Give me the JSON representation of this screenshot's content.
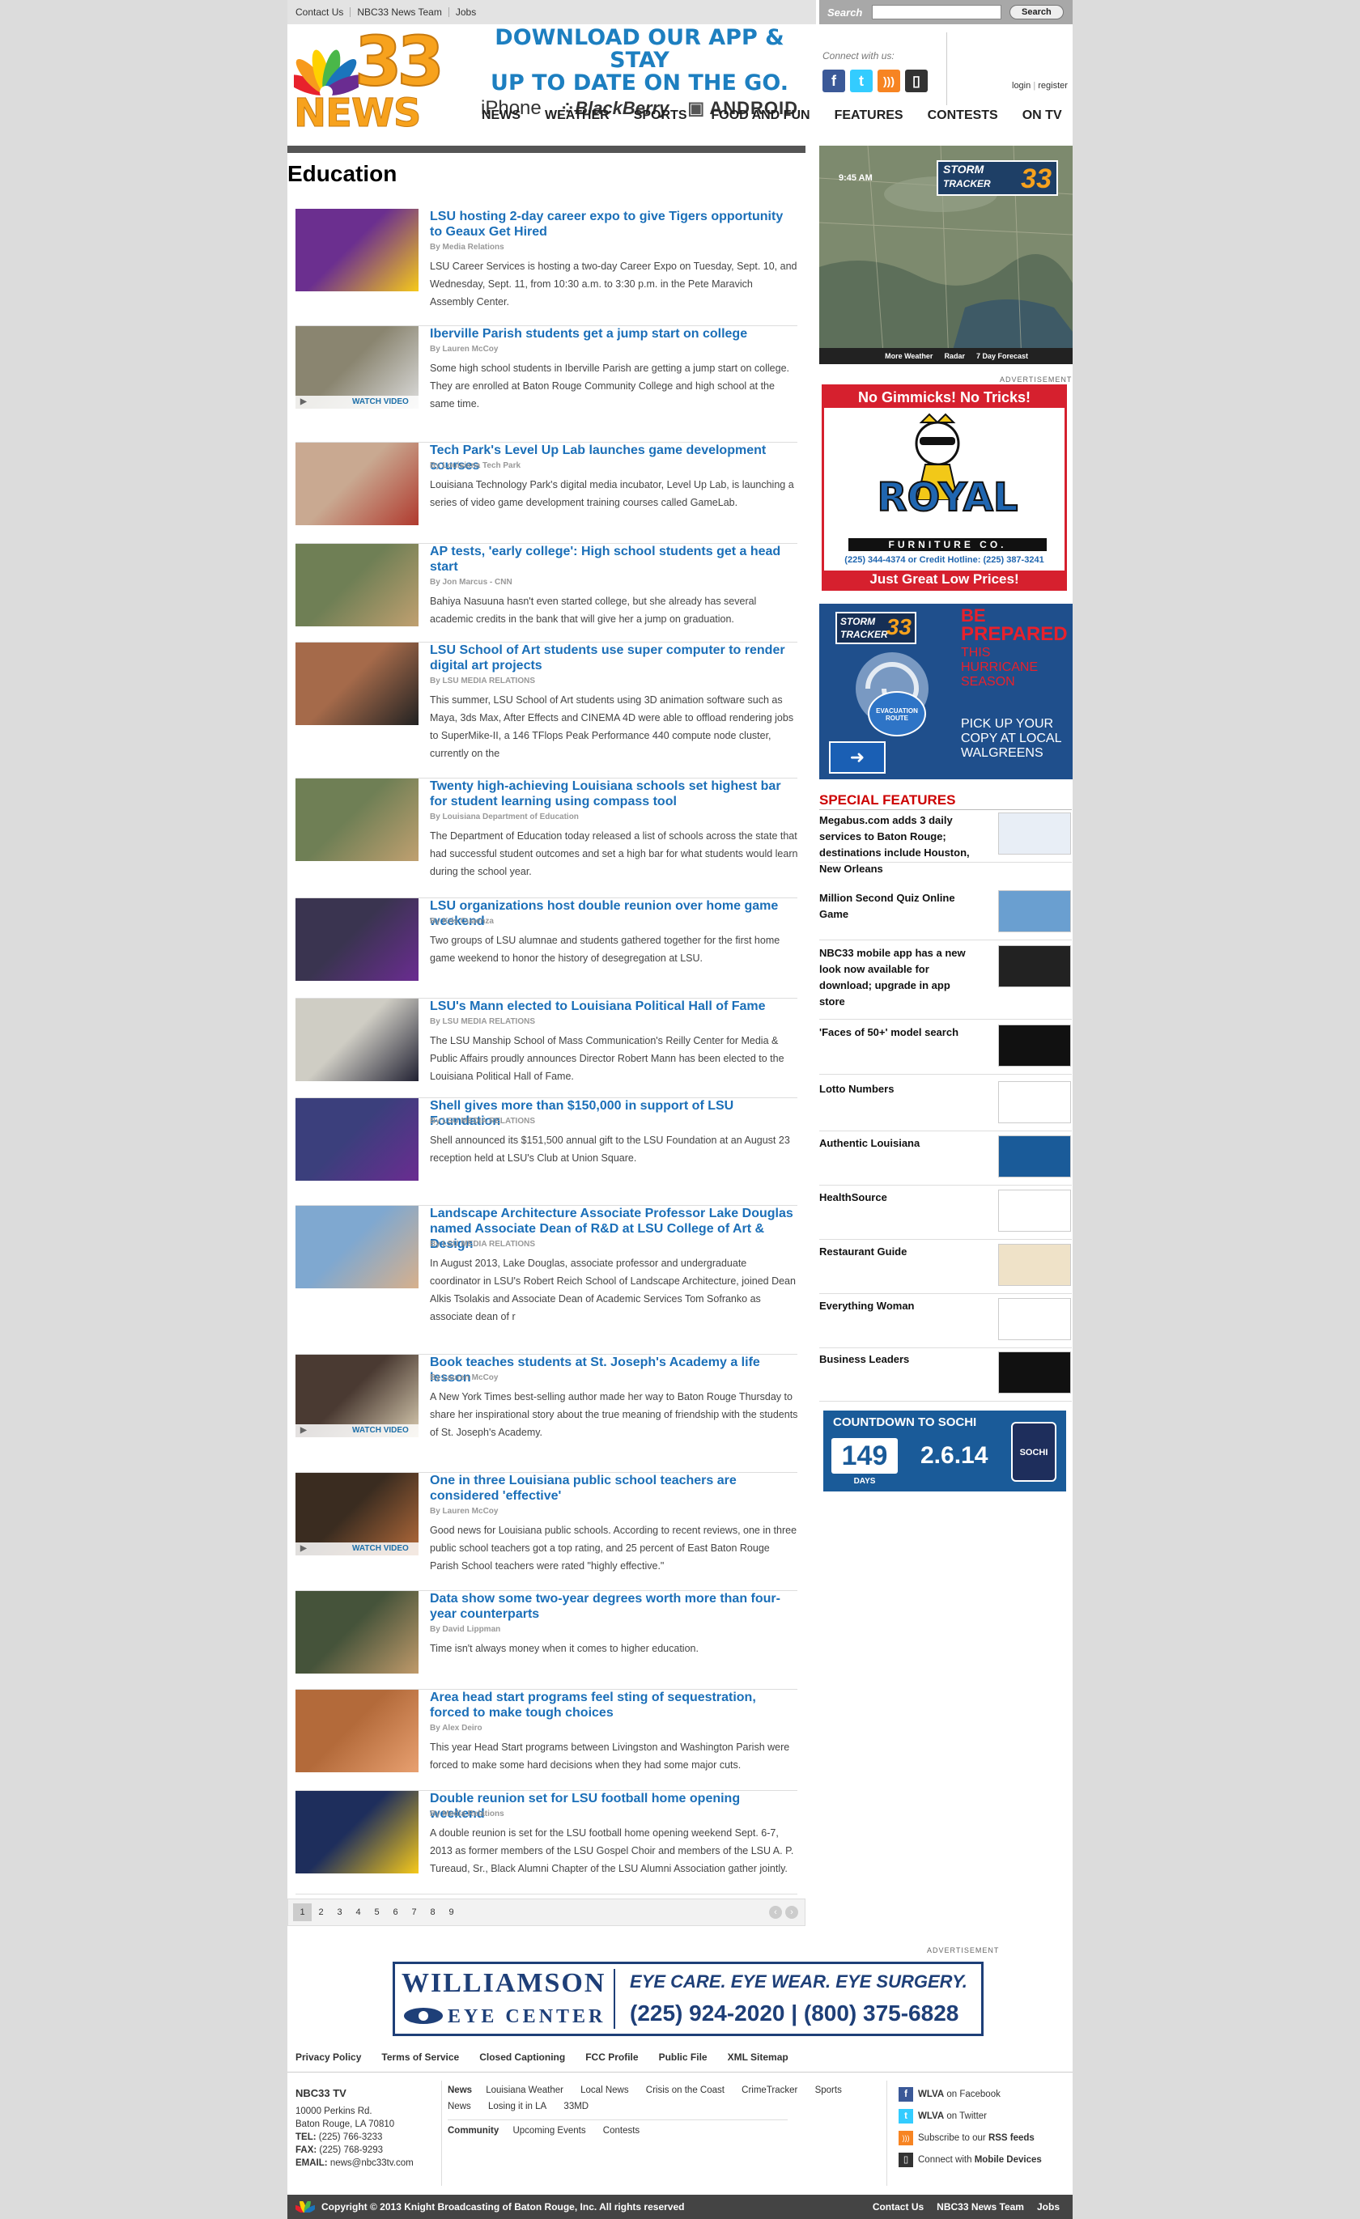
{
  "utility": {
    "links": [
      "Contact Us",
      "NBC33 News Team",
      "Jobs"
    ],
    "search_label": "Search",
    "search_button": "Search"
  },
  "logo": {
    "number": "33",
    "word": "NEWS"
  },
  "promo": {
    "line1": "DOWNLOAD OUR APP & STAY",
    "line2": "UP TO DATE ON THE GO.",
    "platforms": [
      "iPhone",
      "BlackBerry",
      "ANDROID"
    ]
  },
  "connect": {
    "label": "Connect with us:",
    "icons": [
      "facebook-icon",
      "twitter-icon",
      "rss-icon",
      "mobile-icon"
    ]
  },
  "account": {
    "login": "login",
    "register": "register"
  },
  "nav": [
    "NEWS",
    "WEATHER",
    "SPORTS",
    "FOOD AND FUN",
    "FEATURES",
    "CONTESTS",
    "ON TV"
  ],
  "page_title": "Education",
  "articles": [
    {
      "title": "LSU hosting 2-day career expo to give Tigers opportunity to Geaux Get Hired",
      "byline": "By Media Relations",
      "desc": "LSU Career Services is hosting a two-day Career Expo on Tuesday, Sept. 10, and Wednesday, Sept. 11, from 10:30 a.m. to 3:30 p.m. in the Pete Maravich Assembly Center.",
      "video": false
    },
    {
      "title": "Iberville Parish students get a jump start on college",
      "byline": "By Lauren McCoy",
      "desc": "Some high school students in Iberville Parish are getting a jump start on college. They are enrolled at Baton Rouge Community College and high school at the same time.",
      "video": true
    },
    {
      "title": "Tech Park's Level Up Lab launches game development courses",
      "byline": "By Louisiana Tech Park",
      "desc": "Louisiana Technology Park's digital media incubator, Level Up Lab, is launching a series of video game development training courses called GameLab.",
      "video": false
    },
    {
      "title": "AP tests, 'early college': High school students get a head start",
      "byline": "By Jon Marcus - CNN",
      "desc": "Bahiya Nasuuna hasn't even started college, but she already has several academic credits in the bank that will give her a jump on graduation.",
      "video": false
    },
    {
      "title": "LSU School of Art students use super computer to render digital art projects",
      "byline": "By LSU MEDIA RELATIONS",
      "desc": "This summer, LSU School of Art students using 3D animation software such as Maya, 3ds Max, After Effects and CINEMA 4D were able to offload rendering jobs to SuperMike-II, a 146 TFlops Peak Performance 440 compute node cluster, currently on the",
      "video": false
    },
    {
      "title": "Twenty high-achieving Louisiana schools set highest bar for student learning using compass tool",
      "byline": "By Louisiana Department of Education",
      "desc": "The Department of Education today released a list of schools across the state that had successful student outcomes and set a high bar for what students would learn during the school year.",
      "video": false
    },
    {
      "title": "LSU organizations host double reunion over home game weekend",
      "byline": "By Kris Cuaenza",
      "desc": "Two groups of LSU alumnae and students gathered together for the first home game weekend to honor the history of desegregation at LSU.",
      "video": false
    },
    {
      "title": "LSU's Mann elected to Louisiana Political Hall of Fame",
      "byline": "By LSU MEDIA RELATIONS",
      "desc": "The LSU Manship School of Mass Communication's Reilly Center for Media & Public Affairs proudly announces Director Robert Mann has been elected to the Louisiana Political Hall of Fame.",
      "video": false
    },
    {
      "title": "Shell gives more than $150,000 in support of LSU Foundation",
      "byline": "By LSU MEDIA RELATIONS",
      "desc": "Shell announced its $151,500 annual gift to the LSU Foundation at an August 23 reception held at LSU's Club at Union Square.",
      "video": false
    },
    {
      "title": "Landscape Architecture Associate Professor Lake Douglas named Associate Dean of R&D at LSU College of Art & Design",
      "byline": "By LSU MEDIA RELATIONS",
      "desc": "In August 2013, Lake Douglas, associate professor and undergraduate coordinator in LSU's Robert Reich School of Landscape Architecture, joined Dean Alkis Tsolakis and Associate Dean of Academic Services Tom Sofranko as associate dean of r",
      "video": false
    },
    {
      "title": "Book teaches students at St. Joseph's Academy a life lesson",
      "byline": "By Lauren McCoy",
      "desc": "A New York Times best-selling author made her way to Baton Rouge Thursday to share her inspirational story about the true meaning of friendship with the students of St. Joseph's Academy.",
      "video": true
    },
    {
      "title": "One in three Louisiana public school teachers are considered 'effective'",
      "byline": "By Lauren McCoy",
      "desc": "Good news for Louisiana public schools. According to recent reviews, one in three public school teachers got a top rating, and 25 percent of East Baton Rouge Parish School teachers were rated \"highly effective.\"",
      "video": true
    },
    {
      "title": "Data show some two-year degrees worth more than four-year counterparts",
      "byline": "By David Lippman",
      "desc": "Time isn't always money when it comes to higher education.",
      "video": false
    },
    {
      "title": "Area head start programs feel sting of sequestration, forced to make tough choices",
      "byline": "By Alex Deiro",
      "desc": "This year Head Start programs between Livingston and Washington Parish were forced to make some hard decisions when they had some major cuts.",
      "video": false
    },
    {
      "title": "Double reunion set for LSU football home opening weekend",
      "byline": "By Media Relations",
      "desc": "A double reunion is set for the LSU football home opening weekend Sept. 6-7, 2013 as former members of the LSU Gospel Choir and members of the LSU A. P. Tureaud, Sr., Black Alumni Chapter of the LSU Alumni Association gather jointly.",
      "video": false
    }
  ],
  "watch_video": "WATCH VIDEO",
  "pager": [
    "1",
    "2",
    "3",
    "4",
    "5",
    "6",
    "7",
    "8",
    "9"
  ],
  "weather": {
    "time": "9:45 AM",
    "brand1": "STORM",
    "brand2": "TRACKER",
    "brand_num": "33",
    "links": [
      "More Weather",
      "Radar",
      "7 Day Forecast"
    ]
  },
  "advertisement_label": "ADVERTISEMENT",
  "royal_ad": {
    "top": "No Gimmicks! No Tricks!",
    "name": "ROYAL",
    "sub": "FURNITURE CO.",
    "phone": "(225) 344-4374 or Credit Hotline: (225) 387-3241",
    "bottom": "Just Great Low Prices!"
  },
  "hurricane_ad": {
    "l1": "BE",
    "l2": "PREPARED",
    "l3": "THIS HURRICANE SEASON",
    "l4": "PICK UP YOUR COPY AT LOCAL WALGREENS",
    "sign": "EVACUATION ROUTE"
  },
  "special_features_title": "SPECIAL FEATURES",
  "special_features": [
    "Megabus.com adds 3 daily services to Baton Rouge; destinations include Houston, New Orleans",
    "Million Second Quiz Online Game",
    "NBC33 mobile app has a new look now available for download; upgrade in app store",
    "'Faces of 50+' model search",
    "Lotto Numbers",
    "Authentic Louisiana",
    "HealthSource",
    "Restaurant Guide",
    "Everything Woman",
    "Business Leaders"
  ],
  "sochi": {
    "title": "COUNTDOWN TO SOCHI",
    "days": "149",
    "days_label": "DAYS",
    "date": "2.6.14",
    "badge": "SOCHI"
  },
  "williamson": {
    "name1": "WILLIAMSON",
    "name2": "EYE CENTER",
    "tag": "EYE CARE. EYE WEAR. EYE SURGERY.",
    "phones": "(225) 924-2020 | (800) 375-6828"
  },
  "footer_links": [
    "Privacy Policy",
    "Terms of Service",
    "Closed Captioning",
    "FCC Profile",
    "Public File",
    "XML Sitemap"
  ],
  "station": {
    "name": "NBC33 TV",
    "addr1": "10000 Perkins Rd.",
    "addr2": "Baton Rouge, LA 70810",
    "tel": "(225) 766-3233",
    "fax": "(225) 768-9293",
    "email": "news@nbc33tv.com"
  },
  "news_links": [
    "News",
    "Louisiana Weather",
    "Local News",
    "Crisis on the Coast",
    "CrimeTracker",
    "Sports",
    "News",
    "Losing it in LA",
    "33MD"
  ],
  "community_links": [
    "Community",
    "Upcoming Events",
    "Contests"
  ],
  "social": [
    {
      "pre": "WLVA",
      "post": " on Facebook"
    },
    {
      "pre": "WLVA",
      "post": " on Twitter"
    },
    {
      "pre": "Subscribe to our ",
      "post": "RSS feeds"
    },
    {
      "pre": "Connect with ",
      "post": "Mobile Devices"
    }
  ],
  "copyright": "Copyright © 2013 Knight Broadcasting of Baton Rouge, Inc. All rights reserved",
  "bottom_links": [
    "Contact Us",
    "NBC33 News Team",
    "Jobs"
  ]
}
